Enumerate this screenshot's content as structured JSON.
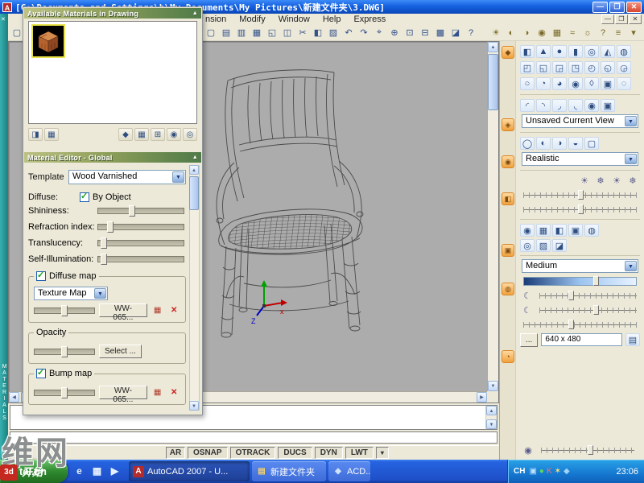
{
  "glyphs": {
    "check": "✓",
    "up": "▲",
    "down": "▼",
    "left": "◀",
    "right": "▶"
  },
  "titlebar": {
    "icon": "A",
    "title": "[C:\\Documents and Settings\\h\\My Documents\\My Pictures\\新建文件夹\\3.DWG]",
    "minimize": "—",
    "maximize": "❐",
    "close": "✕"
  },
  "menubar": {
    "items": [
      "nsion",
      "Modify",
      "Window",
      "Help",
      "Express"
    ],
    "child": [
      "—",
      "❐",
      "✕"
    ]
  },
  "toolbar": {
    "fragment": [
      {
        "name": "qnew",
        "glyph": "▢"
      }
    ],
    "main": [
      {
        "name": "new",
        "glyph": "▢"
      },
      {
        "name": "open",
        "glyph": "▤"
      },
      {
        "name": "save",
        "glyph": "▥"
      },
      {
        "name": "plot",
        "glyph": "▦"
      },
      {
        "name": "plot-preview",
        "glyph": "◱"
      },
      {
        "name": "publish",
        "glyph": "◫"
      },
      {
        "name": "cut",
        "glyph": "✂"
      },
      {
        "name": "copy",
        "glyph": "◧"
      },
      {
        "name": "paste",
        "glyph": "▨"
      },
      {
        "name": "undo",
        "glyph": "↶"
      },
      {
        "name": "redo",
        "glyph": "↷"
      },
      {
        "name": "pan",
        "glyph": "⌖"
      },
      {
        "name": "zoom-realtime",
        "glyph": "⊕"
      },
      {
        "name": "zoom-window",
        "glyph": "⊡"
      },
      {
        "name": "zoom-previous",
        "glyph": "⊟"
      },
      {
        "name": "designcenter",
        "glyph": "▩"
      },
      {
        "name": "tool-palettes",
        "glyph": "◪"
      },
      {
        "name": "help",
        "glyph": "?"
      }
    ],
    "right": [
      {
        "name": "lights",
        "glyph": "☀"
      },
      {
        "name": "hide",
        "glyph": "◐"
      },
      {
        "name": "visual-styles",
        "glyph": "◑"
      },
      {
        "name": "render-region",
        "glyph": "◉"
      },
      {
        "name": "materials",
        "glyph": "▦"
      },
      {
        "name": "fog",
        "glyph": "≈"
      },
      {
        "name": "render",
        "glyph": "☼"
      },
      {
        "name": "info",
        "glyph": "?"
      },
      {
        "name": "overflow",
        "glyph": "≡"
      },
      {
        "name": "more",
        "glyph": "▾"
      }
    ]
  },
  "palette": {
    "strip": {
      "close": "✕",
      "label": "MATERIALS",
      "bottom_icon": "▤"
    },
    "header": "Available Materials in Drawing",
    "collapse": "▲",
    "tools_left": [
      {
        "name": "create-material",
        "glyph": "◨"
      },
      {
        "name": "purge-material",
        "glyph": "▦"
      }
    ],
    "tools_right": [
      {
        "name": "swatch-geometry",
        "glyph": "◆"
      },
      {
        "name": "checkered-underlay",
        "glyph": "▦"
      },
      {
        "name": "preview-size",
        "glyph": "⊞"
      },
      {
        "name": "apply-material",
        "glyph": "◉"
      },
      {
        "name": "indicate-selection",
        "glyph": "◎"
      }
    ],
    "editor_header": "Material Editor - Global",
    "template_label": "Template",
    "template_value": "Wood Varnished",
    "diffuse_label": "Diffuse:",
    "by_object_label": "By Object",
    "sliders": [
      {
        "label": "Shininess:",
        "thumb": "left:36%"
      },
      {
        "label": "Refraction index:",
        "thumb": "left:10%"
      },
      {
        "label": "Translucency:",
        "thumb": "left:3%"
      },
      {
        "label": "Self-Illumination:",
        "thumb": "left:3%"
      }
    ],
    "diffuse_map": {
      "title": "Diffuse map",
      "combo_value": "Texture Map",
      "file_button": "WW-065...",
      "checker_icon": "▦",
      "delete_icon": "✕"
    },
    "opacity": {
      "title": "Opacity",
      "select_button": "Select ..."
    },
    "bump_map": {
      "title": "Bump map",
      "file_button": "WW-065...",
      "checker_icon": "▦",
      "delete_icon": "✕"
    }
  },
  "drawing": {
    "ucs_x": "x",
    "ucs_z": "Z"
  },
  "dashboard": {
    "launchers": [
      "◆",
      "◈",
      "◉",
      "◧",
      "▣",
      "◍",
      "◔"
    ],
    "make_row1": [
      "◧",
      "▲",
      "●",
      "▮",
      "◎",
      "◭",
      "◍"
    ],
    "make_row2": [
      "◰",
      "◱",
      "◲",
      "◳",
      "◴",
      "◵",
      "◶"
    ],
    "make_row3": [
      "○",
      "◔",
      "◕",
      "◉",
      "◊",
      "▣",
      "◌"
    ],
    "nav_row": [
      "◜",
      "◝",
      "◞",
      "◟",
      "◉",
      "▣"
    ],
    "view_combo": "Unsaved Current View",
    "style_row": [
      "◯",
      "◐",
      "◑",
      "◒",
      "▢"
    ],
    "style_combo": "Realistic",
    "light_row": [
      "☀",
      "❄",
      "☀",
      "❄"
    ],
    "mat_row1": [
      "◉",
      "▦",
      "◧",
      "▣",
      "◍"
    ],
    "mat_row2": [
      "◎",
      "▨",
      "◪"
    ],
    "quality_combo": "Medium",
    "moon_icon": "☾",
    "more_button": "...",
    "resolution": "640 x 480",
    "render_icon": "▤",
    "bottom_icon": "◉"
  },
  "statusbar": {
    "partial": "AR",
    "toggles": [
      "OSNAP",
      "OTRACK",
      "DUCS",
      "DYN",
      "LWT"
    ],
    "extra": "▾"
  },
  "taskbar": {
    "start_label": "开始",
    "quick": [
      {
        "name": "internet-explorer",
        "glyph": "e"
      },
      {
        "name": "show-desktop",
        "glyph": "▦"
      },
      {
        "name": "media-player",
        "glyph": "▶"
      }
    ],
    "tasks": [
      {
        "icon": "A",
        "icon_style": "background:#B52A2A;color:#fff",
        "label": "AutoCAD 2007 - U...",
        "active": "true"
      },
      {
        "icon": "▤",
        "icon_style": "color:#F5D36B",
        "label": "新建文件夹",
        "active": "false"
      },
      {
        "icon": "◆",
        "icon_style": "color:#CFE3FF",
        "label": "ACD...",
        "active": "false"
      }
    ],
    "tray": {
      "lang": "CH",
      "icons": [
        {
          "glyph": "▣",
          "style": "color:#BFE3FF"
        },
        {
          "glyph": "●",
          "style": "color:#5ED65E"
        },
        {
          "glyph": "K",
          "style": "color:#FF6B6B"
        },
        {
          "glyph": "✶",
          "style": "color:#FFE06B"
        },
        {
          "glyph": "◆",
          "style": "color:#9FD4FF"
        }
      ],
      "time": "23:06"
    }
  },
  "watermark": {
    "big": "维网",
    "small": "tal.cn",
    "badge": "3d"
  }
}
